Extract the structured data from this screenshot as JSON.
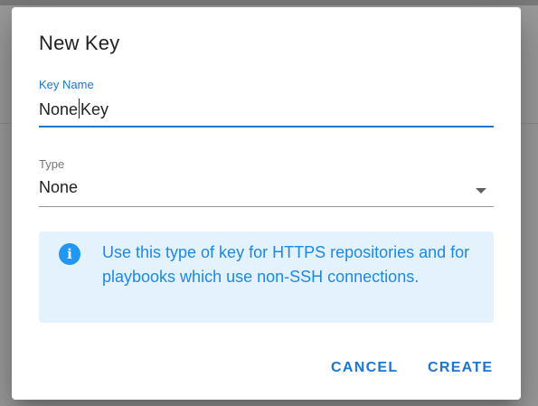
{
  "dialog": {
    "title": "New Key",
    "key_name": {
      "label": "Key Name",
      "value_before_caret": "None",
      "value_after_caret": "Key"
    },
    "type": {
      "label": "Type",
      "selected": "None"
    },
    "info": {
      "icon": "info-icon",
      "text": "Use this type of key for HTTPS repositories and for playbooks which use non-SSH connections."
    },
    "buttons": {
      "cancel": "CANCEL",
      "create": "CREATE"
    }
  },
  "colors": {
    "accent": "#1976d2",
    "info_background": "#e3f2fd",
    "info_text": "#1e88e5",
    "info_icon": "#2196f3"
  }
}
